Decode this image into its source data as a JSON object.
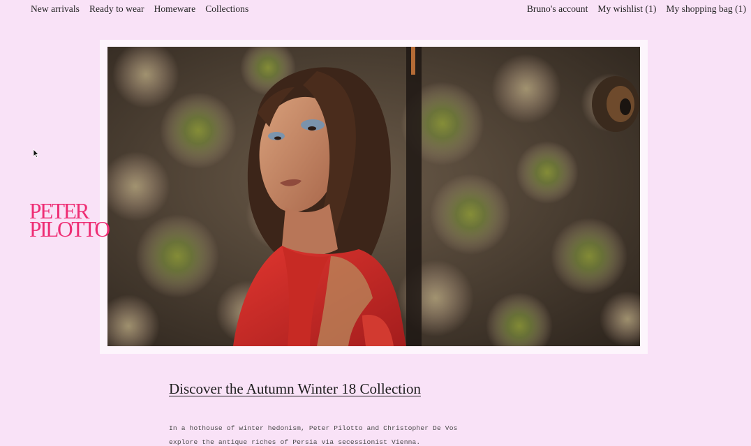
{
  "nav": {
    "left": [
      {
        "label": "New arrivals"
      },
      {
        "label": "Ready to wear"
      },
      {
        "label": "Homeware"
      },
      {
        "label": "Collections"
      }
    ],
    "right": [
      {
        "label": "Bruno's account"
      },
      {
        "label": "My wishlist (1)"
      },
      {
        "label": "My shopping bag (1)"
      }
    ]
  },
  "brand": {
    "logo_line1": "PETER",
    "logo_line2": "PILOTTO",
    "logo_color": "#ee2d74"
  },
  "colors": {
    "page_background": "#f9e2f7"
  },
  "hero": {
    "image_icon": "model-in-red-jacket-photo"
  },
  "content": {
    "headline": "Discover the Autumn Winter 18 Collection",
    "body_line1": "In a hothouse of winter hedonism, Peter Pilotto and Christopher De Vos",
    "body_line2": "explore the antique riches of Persia via secessionist Vienna."
  },
  "cursor": {
    "icon": "mouse-pointer-icon"
  }
}
